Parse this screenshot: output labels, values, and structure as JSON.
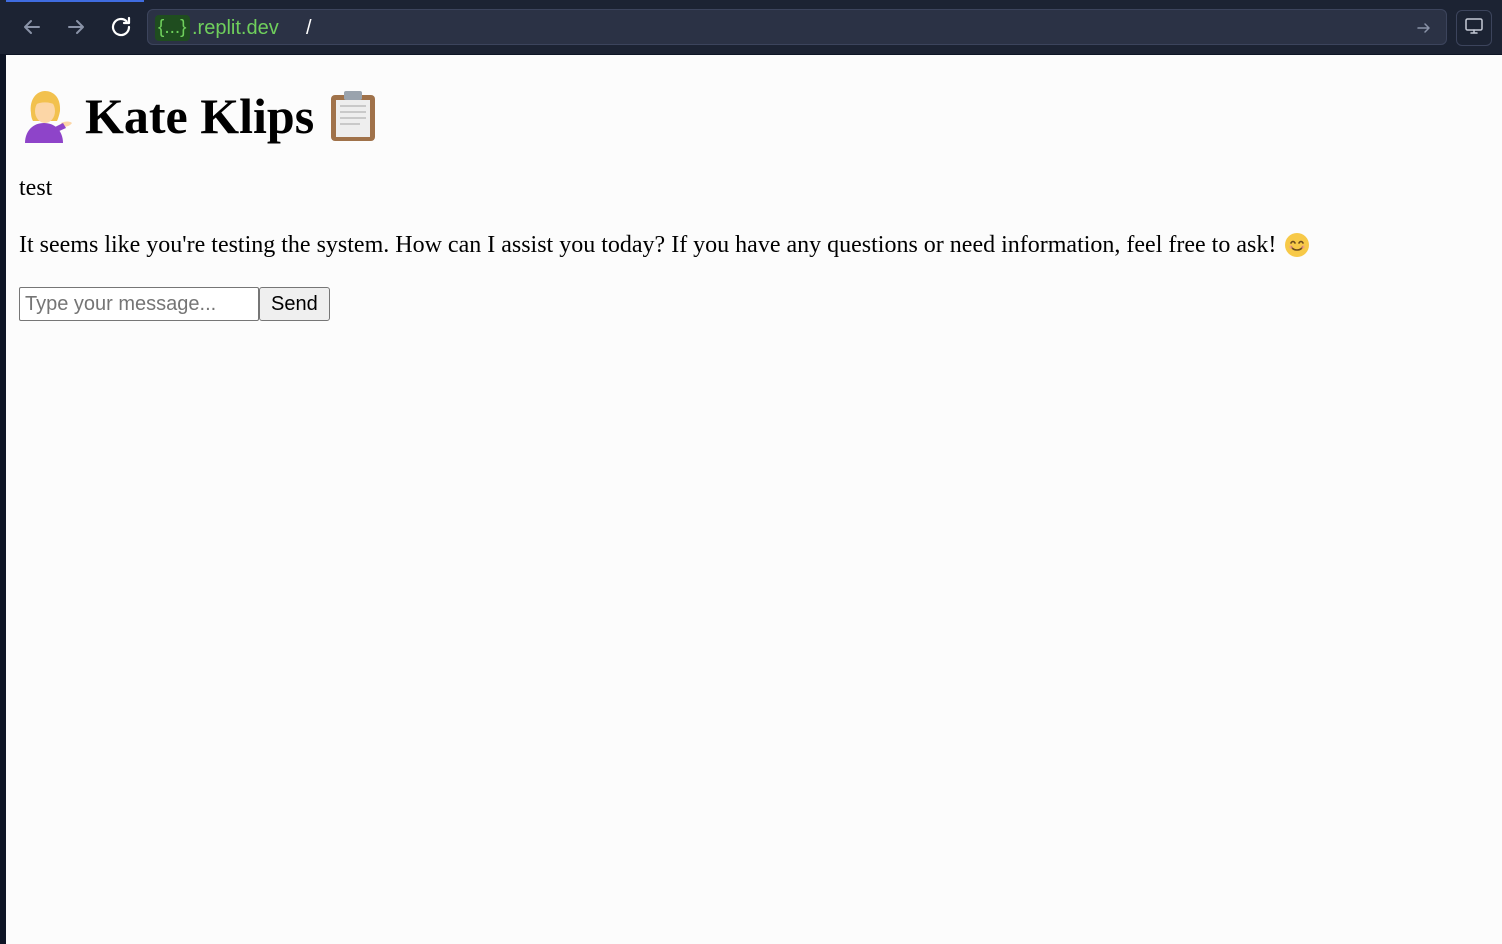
{
  "browser": {
    "url_badge": "{...}",
    "url_domain": ".replit.dev",
    "url_path": "/",
    "icons": [
      "back-arrow-icon",
      "forward-arrow-icon",
      "reload-icon",
      "go-arrow-icon",
      "monitor-icon"
    ]
  },
  "app": {
    "title": "Kate Klips",
    "title_emoji_left": "woman-tipping-hand",
    "title_emoji_right": "clipboard"
  },
  "messages": [
    {
      "role": "user",
      "text": "test"
    },
    {
      "role": "assistant",
      "text": "It seems like you're testing the system. How can I assist you today? If you have any questions or need information, feel free to ask!",
      "emoji": "smiling-face"
    }
  ],
  "input": {
    "placeholder": "Type your message...",
    "value": ""
  },
  "send_button": {
    "label": "Send"
  },
  "colors": {
    "chrome_bg": "#1c2333",
    "url_green": "#6fcf5c",
    "page_bg": "#fcfcfc"
  }
}
